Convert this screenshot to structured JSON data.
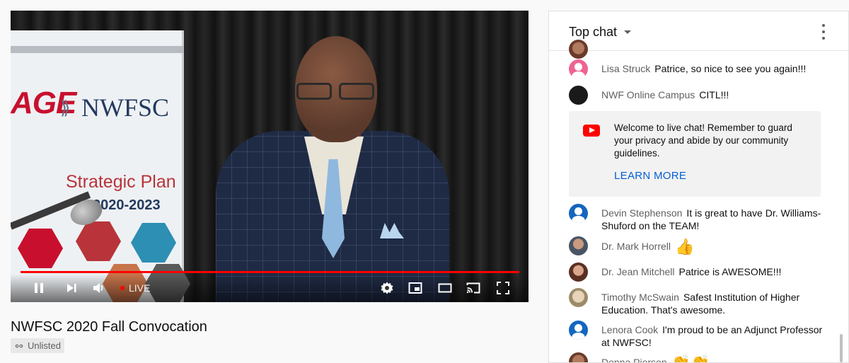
{
  "player": {
    "banner": {
      "logo_left": "AGE",
      "logo_right": "NWFSC",
      "plan": "Strategic Plan",
      "years": "2020-2023"
    },
    "progress": 1.0,
    "live_label": "LIVE",
    "icons": [
      "pause-icon",
      "next-icon",
      "volume-icon",
      "settings-icon",
      "miniplayer-icon",
      "theater-icon",
      "cast-icon",
      "fullscreen-icon"
    ],
    "accent": "#ff0000"
  },
  "video": {
    "title": "NWFSC 2020 Fall Convocation",
    "visibility": "Unlisted"
  },
  "chat": {
    "title": "Top chat",
    "messages_top": [
      {
        "author": "Lisa Struck",
        "text": "Patrice, so nice to see you again!!!"
      },
      {
        "author": "NWF Online Campus",
        "text": "CITL!!!"
      }
    ],
    "welcome": {
      "text": "Welcome to live chat! Remember to guard your privacy and abide by our community guidelines.",
      "link": "LEARN MORE"
    },
    "messages": [
      {
        "author": "Devin Stephenson",
        "text": "It is great to have Dr. Williams-Shuford on the TEAM!"
      },
      {
        "author": "Dr. Mark Horrell",
        "text": "👍"
      },
      {
        "author": "Dr. Jean Mitchell",
        "text": "Patrice is AWESOME!!!"
      },
      {
        "author": "Timothy McSwain",
        "text": "Safest Institution of Higher Education. That's awesome."
      },
      {
        "author": "Lenora Cook",
        "text": "I'm proud to be an Adjunct Professor at NWFSC!"
      },
      {
        "author": "Donna Pierson",
        "text": "👏👏"
      }
    ],
    "link_color": "#065fd4"
  }
}
